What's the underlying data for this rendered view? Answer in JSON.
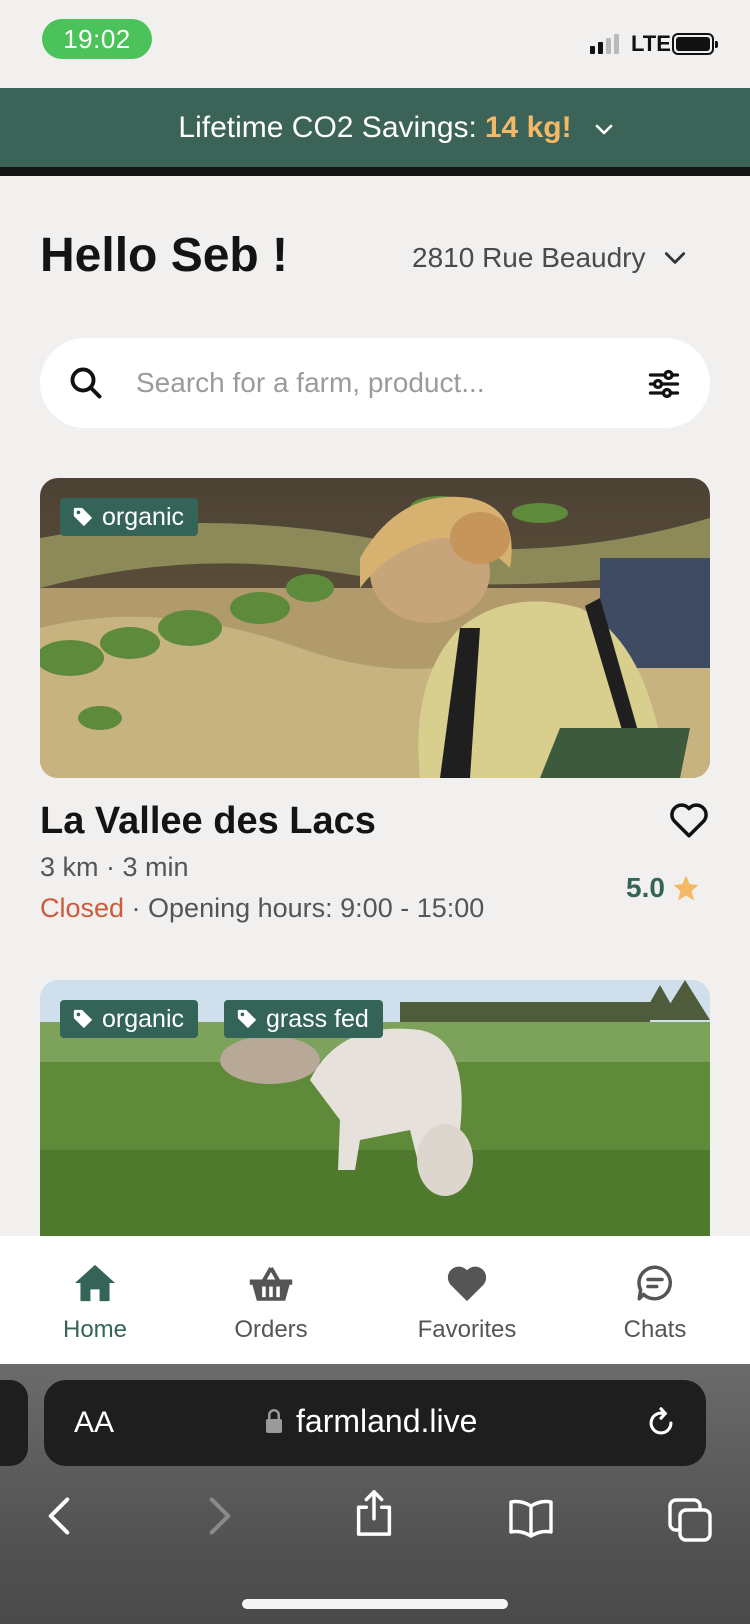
{
  "status_bar": {
    "time": "19:02",
    "network": "LTE"
  },
  "banner": {
    "label": "Lifetime CO2 Savings:",
    "amount": "14 kg!"
  },
  "header": {
    "greeting": "Hello Seb !",
    "address": "2810 Rue Beaudry"
  },
  "search": {
    "placeholder": "Search for a farm, product..."
  },
  "farms": [
    {
      "tags": [
        "organic"
      ],
      "name": "La Vallee des Lacs",
      "distance": "3 km · 3 min",
      "status": "Closed",
      "hours": " · Opening hours: 9:00 - 15:00",
      "rating": "5.0"
    },
    {
      "tags": [
        "organic",
        "grass fed"
      ]
    }
  ],
  "tabs": [
    {
      "label": "Home"
    },
    {
      "label": "Orders"
    },
    {
      "label": "Favorites"
    },
    {
      "label": "Chats"
    }
  ],
  "browser": {
    "text_size": "AA",
    "url": "farmland.live"
  },
  "colors": {
    "brand": "#3c6358",
    "accent": "#f5b866",
    "closed": "#cc5a3c",
    "star": "#f5b866"
  },
  "icons": [
    "chevron-down-icon",
    "search-icon",
    "filter-icon",
    "tag-icon",
    "heart-outline-icon",
    "star-icon",
    "home-icon",
    "basket-icon",
    "heart-icon",
    "chat-icon",
    "lock-icon",
    "reload-icon",
    "back-icon",
    "forward-icon",
    "share-icon",
    "bookmarks-icon",
    "tabs-icon"
  ]
}
